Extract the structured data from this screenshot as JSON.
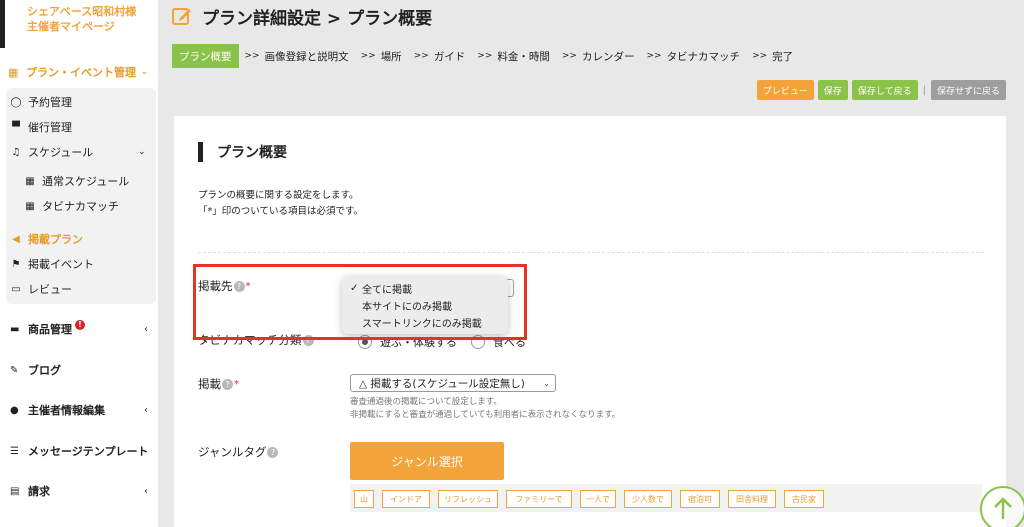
{
  "brand": {
    "line1": "シェアベース昭和村様",
    "line2": "主催者マイページ"
  },
  "sidebar": {
    "plan_event": "プラン・イベント管理",
    "items": [
      {
        "label": "予約管理",
        "icon": "chat-icon"
      },
      {
        "label": "催行管理",
        "icon": "store-icon"
      },
      {
        "label": "スケジュール",
        "icon": "bell-icon"
      },
      {
        "label": "通常スケジュール",
        "icon": "calendar-icon"
      },
      {
        "label": "タビナカマッチ",
        "icon": "calendar-icon"
      },
      {
        "label": "掲載プラン",
        "icon": "megaphone-icon"
      },
      {
        "label": "掲載イベント",
        "icon": "flag-icon"
      },
      {
        "label": "レビュー",
        "icon": "comment-icon"
      }
    ],
    "menu": [
      {
        "label": "商品管理",
        "badge": "!"
      },
      {
        "label": "ブログ"
      },
      {
        "label": "主催者情報編集"
      },
      {
        "label": "メッセージテンプレート"
      },
      {
        "label": "請求"
      }
    ]
  },
  "header": {
    "title": "プラン詳細設定 > プラン概要"
  },
  "steps": [
    "プラン概要",
    "画像登録と説明文",
    "場所",
    "ガイド",
    "料金・時間",
    "カレンダー",
    "タビナカマッチ",
    "完了"
  ],
  "step_sep": ">>",
  "actions": {
    "preview": "プレビュー",
    "save": "保存",
    "save_back": "保存して戻る",
    "bar": "|",
    "nosave_back": "保存せずに戻る"
  },
  "section": {
    "title": "プラン概要",
    "desc1": "プランの概要に関する設定をします。",
    "desc2": "「*」印のついている項目は必須です。"
  },
  "fields": {
    "listing": {
      "label": "掲載先",
      "help": "?",
      "req": "*"
    },
    "dropdown_options": [
      "全てに掲載",
      "本サイトにのみ掲載",
      "スマートリンクにのみ掲載"
    ],
    "dropdown_check": "✓",
    "tabinaka": {
      "label": "タビナカマッチ分類",
      "help": "?",
      "opt1": "遊ぶ・体験する",
      "opt2": "食べる"
    },
    "publish": {
      "label": "掲載",
      "help": "?",
      "req": "*",
      "value": "△ 掲載する(スケジュール設定無し)",
      "hint1": "審査通過後の掲載について設定します。",
      "hint2": "非掲載にすると審査が通過していても利用者に表示されなくなります。"
    },
    "genre": {
      "label": "ジャンルタグ",
      "help": "?",
      "button": "ジャンル選択",
      "tags": [
        "山",
        "インドア",
        "リフレッシュ",
        "ファミリーで",
        "一人で",
        "少人数で",
        "宿泊可",
        "田舎料理",
        "古民家"
      ]
    }
  },
  "colors": {
    "accent": "#f2a33a",
    "green": "#8bc34a",
    "highlight": "#e53323"
  }
}
